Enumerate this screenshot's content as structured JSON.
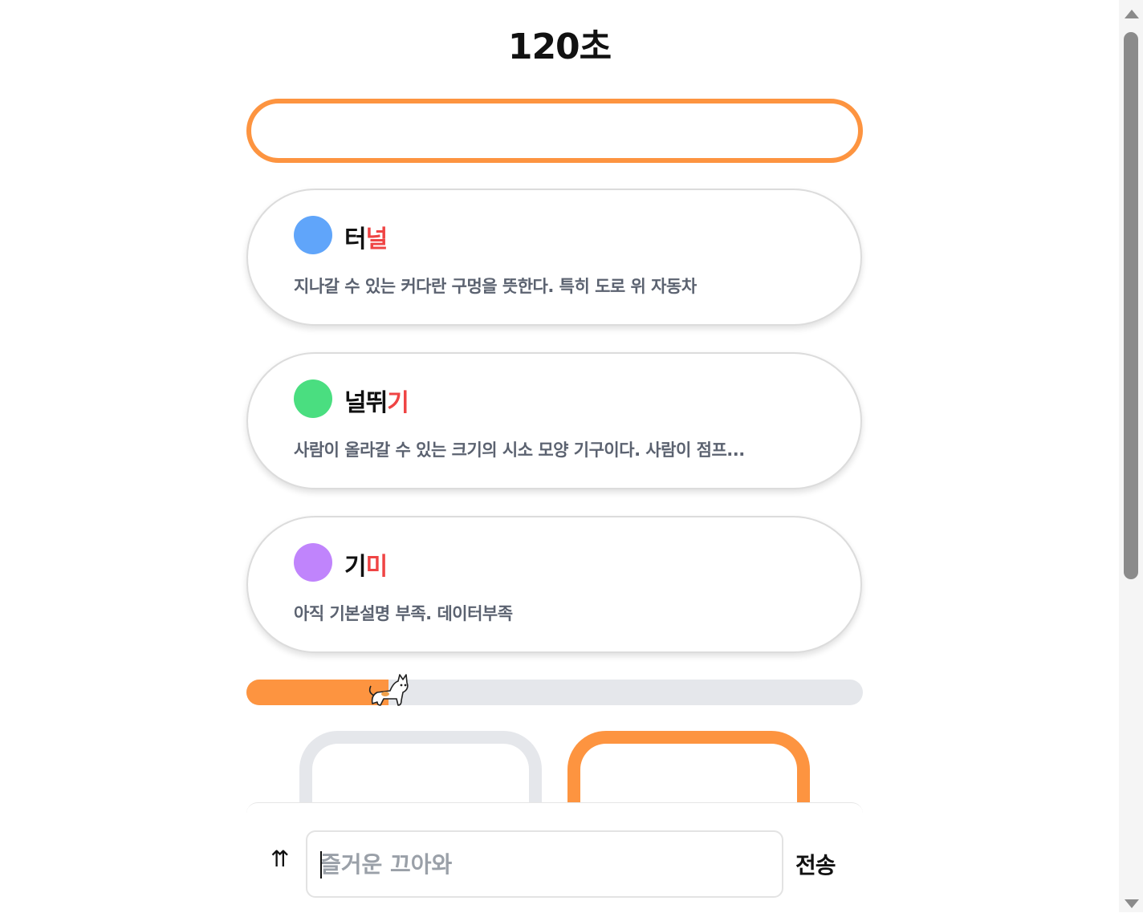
{
  "timer": {
    "label": "120초"
  },
  "answer_input": {
    "value": ""
  },
  "cards": [
    {
      "word_plain": "터",
      "word_highlight": "널",
      "description": "지나갈 수 있는 커다란 구멍을 뜻한다. 특히 도로 위 자동차",
      "dot_color": "#60a5fa"
    },
    {
      "word_plain": "널뛰",
      "word_highlight": "기",
      "description": "사람이 올라갈 수 있는 크기의 시소 모양 기구이다. 사람이 점프...",
      "dot_color": "#4ade80"
    },
    {
      "word_plain": "기",
      "word_highlight": "미",
      "description": "아직 기본설명 부족. 데이터부족",
      "dot_color": "#c084fc"
    }
  ],
  "progress": {
    "fraction": 0.23,
    "fill_color": "#fd9440",
    "track_color": "#e5e7eb",
    "mascot_icon": "cat-icon"
  },
  "chat": {
    "scroll_top_label": "⇈",
    "placeholder": "즐거운 끄아와",
    "send_label": "전송"
  },
  "colors": {
    "accent": "#fd9440",
    "highlight": "#ef4444"
  }
}
